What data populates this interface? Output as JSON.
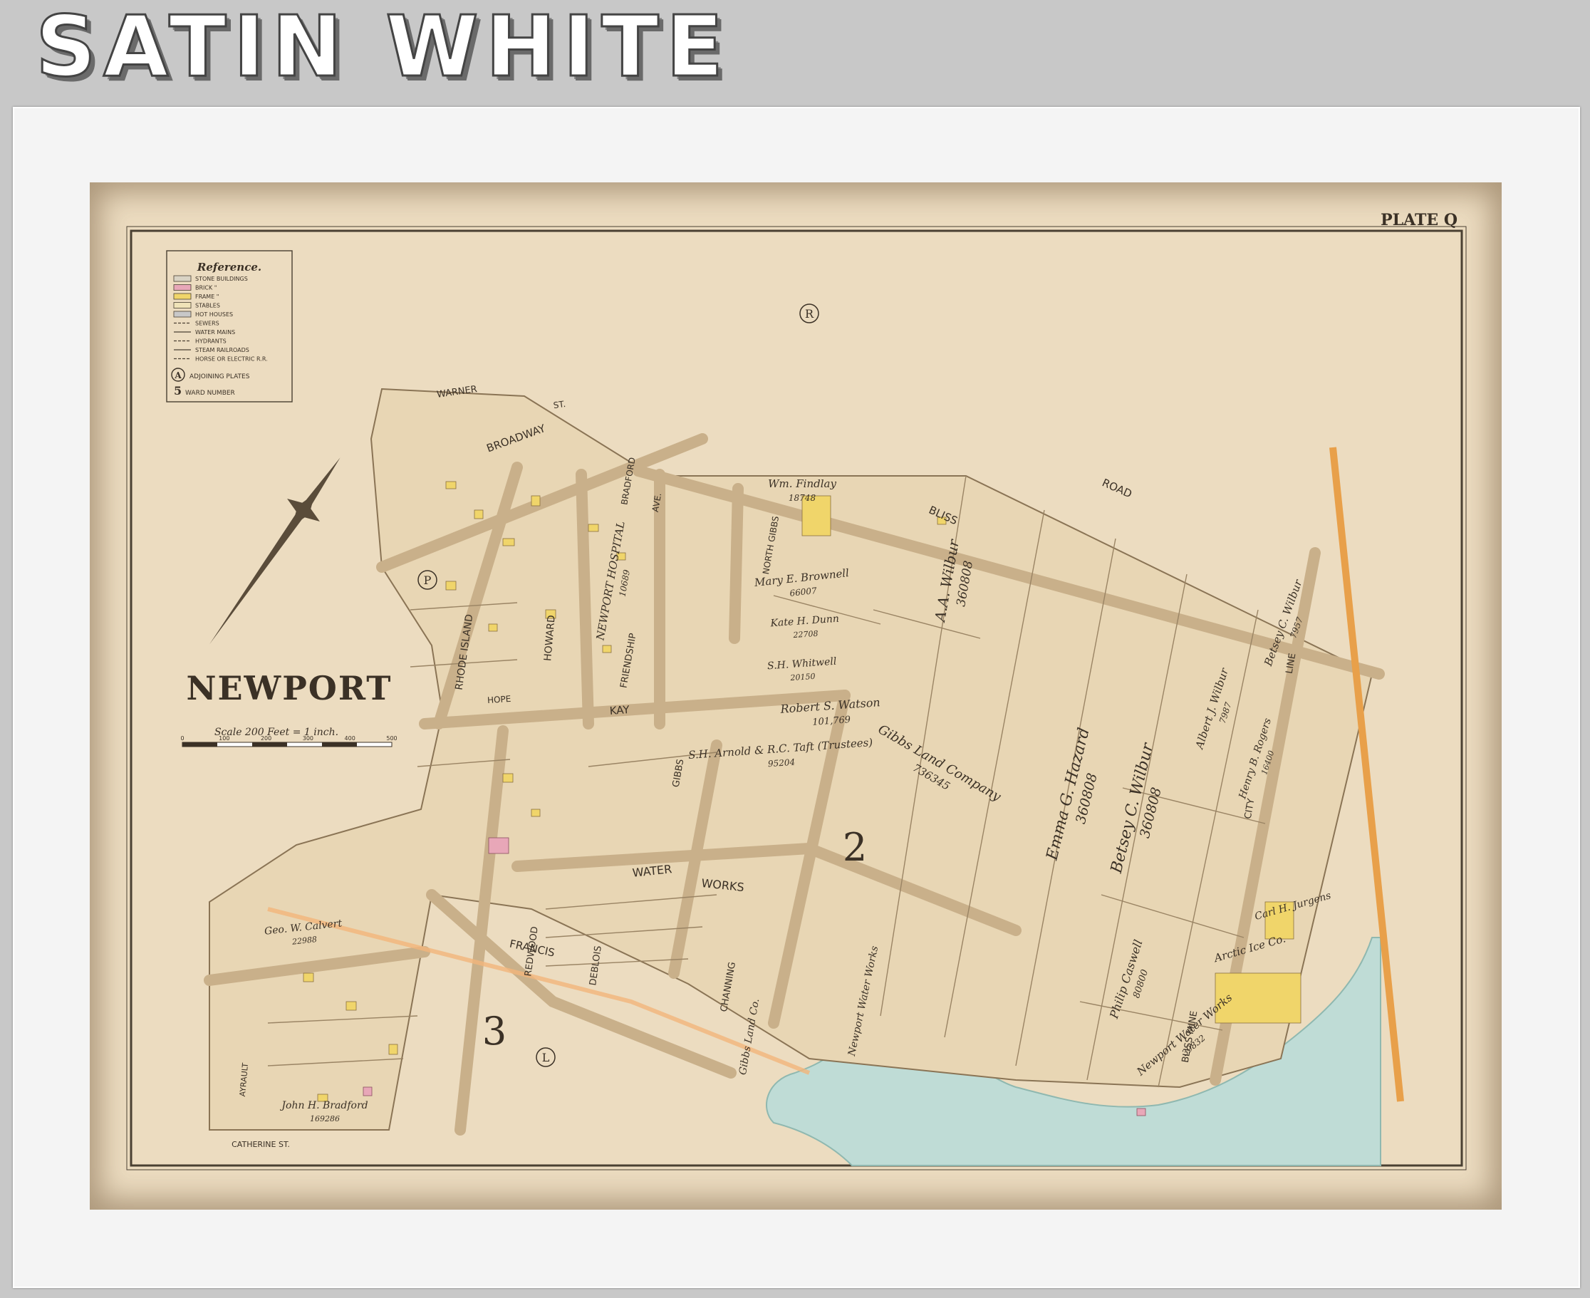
{
  "header": {
    "title": "SATIN WHITE"
  },
  "map": {
    "plate": "PLATE Q",
    "city_name": "NEWPORT",
    "scale_text": "Scale 200 Feet = 1 inch.",
    "scale_ticks": [
      "0",
      "100",
      "200",
      "300",
      "400",
      "500"
    ],
    "reference": {
      "title": "Reference.",
      "items": [
        {
          "label": "STONE BUILDINGS",
          "color": "#d9d3c4"
        },
        {
          "label": "BRICK \"",
          "color": "#e8a7b8"
        },
        {
          "label": "FRAME \"",
          "color": "#f0d56a"
        },
        {
          "label": "STABLES",
          "color": "#f0e3b8"
        },
        {
          "label": "HOT HOUSES",
          "color": "#c8c8c8"
        },
        {
          "label": "SEWERS",
          "color": ""
        },
        {
          "label": "WATER MAINS",
          "color": ""
        },
        {
          "label": "HYDRANTS",
          "color": ""
        },
        {
          "label": "STEAM RAILROADS",
          "color": ""
        },
        {
          "label": "HORSE OR ELECTRIC R.R.",
          "color": ""
        }
      ],
      "adjoining_badge": "A",
      "adjoining_label": "ADJOINING PLATES",
      "ward_badge": "5",
      "ward_label": "WARD NUMBER"
    },
    "adjoining_plates": [
      "R",
      "P",
      "L"
    ],
    "ward_numbers": [
      "2",
      "3"
    ],
    "streets": [
      "WARNER",
      "ST.",
      "BROADWAY",
      "BLISS",
      "ROAD",
      "BRADFORD",
      "AVE.",
      "NORTH GIBBS",
      "RHODE ISLAND",
      "HOWARD",
      "FRIENDSHIP",
      "KAY",
      "GIBBS",
      "WATER",
      "WORKS",
      "FRANCIS",
      "REDWOOD",
      "DEBLOIS",
      "CHANNING",
      "BLISS MINE",
      "CITY",
      "LINE",
      "CATHERINE ST.",
      "AYRAULT",
      "HOPE"
    ],
    "owners": [
      {
        "name": "Wm. Findlay",
        "area": "18748"
      },
      {
        "name": "Mary E. Brownell",
        "area": "66007"
      },
      {
        "name": "Kate H. Dunn",
        "area": "22708"
      },
      {
        "name": "S.H. Whitwell",
        "area": "20150"
      },
      {
        "name": "NEWPORT HOSPITAL",
        "area": "10689"
      },
      {
        "name": "Robert S. Watson",
        "area": "101,769"
      },
      {
        "name": "S.H. Arnold & R.C. Taft (Trustees)",
        "area": "95204"
      },
      {
        "name": "Gibbs Land Company",
        "area": "736345"
      },
      {
        "name": "A.A. Wilbur",
        "area": "360808"
      },
      {
        "name": "Emma G. Hazard",
        "area": "360808"
      },
      {
        "name": "Betsey C. Wilbur",
        "area": "360808"
      },
      {
        "name": "Betsey C. Wilbur",
        "area": "7957"
      },
      {
        "name": "Albert J. Wilbur",
        "area": "7987"
      },
      {
        "name": "Henry B. Rogers",
        "area": "16400"
      },
      {
        "name": "Philip Caswell",
        "area": "80800"
      },
      {
        "name": "Carl H. Jurgens",
        "area": ""
      },
      {
        "name": "Arctic Ice Co.",
        "area": ""
      },
      {
        "name": "Newport Water Works",
        "area": "39832"
      },
      {
        "name": "John H. Bradford",
        "area": "169286"
      },
      {
        "name": "Geo. W. Calvert",
        "area": "22988"
      },
      {
        "name": "Newport Water Works",
        "area": ""
      },
      {
        "name": "Gibbs Land Co.",
        "area": ""
      }
    ]
  },
  "colors": {
    "paper": "#ecdcc0",
    "water": "#bfdcd6",
    "frame_building": "#f0d56a",
    "brick_building": "#e8a7b8",
    "railroad": "#e8a04a",
    "ink": "#3b3126"
  }
}
